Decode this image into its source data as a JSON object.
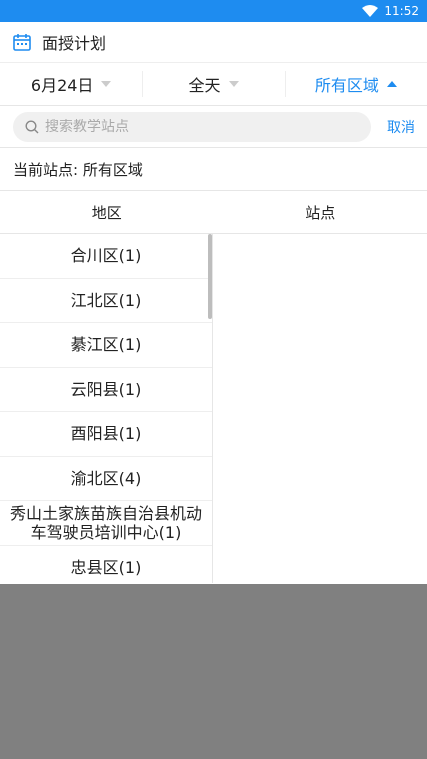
{
  "status_bar": {
    "time": "11:52"
  },
  "app_bar": {
    "title": "面授计划"
  },
  "filters": {
    "date": "6月24日",
    "time_range": "全天",
    "region": "所有区域"
  },
  "search": {
    "placeholder": "搜索教学站点",
    "cancel_label": "取消"
  },
  "current_site": "当前站点: 所有区域",
  "columns": {
    "region": "地区",
    "site": "站点"
  },
  "regions": [
    "合川区(1)",
    "江北区(1)",
    "綦江区(1)",
    "云阳县(1)",
    "酉阳县(1)",
    "渝北区(4)",
    "秀山土家族苗族自治县机动车驾驶员培训中心(1)",
    "忠县区(1)"
  ],
  "colors": {
    "accent": "#1e8cf0",
    "overlay": "#808080"
  }
}
